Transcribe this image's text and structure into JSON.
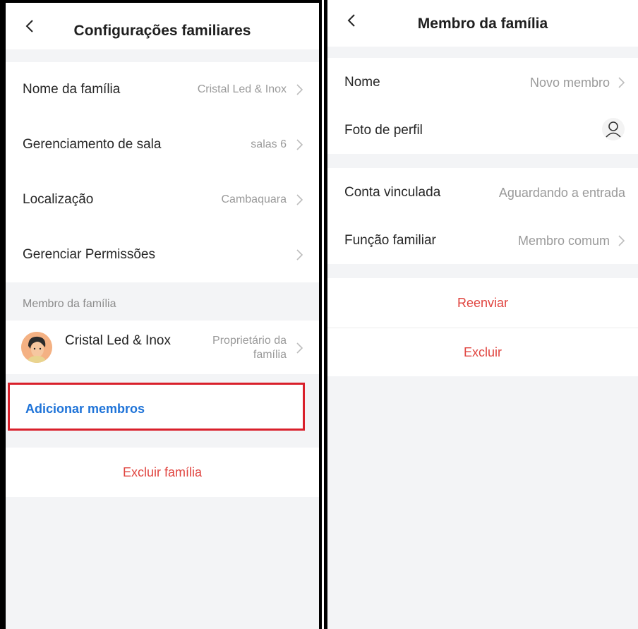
{
  "left": {
    "title": "Configurações familiares",
    "rows": [
      {
        "label": "Nome da família",
        "value": "Cristal Led & Inox"
      },
      {
        "label": "Gerenciamento de sala",
        "value": "salas 6"
      },
      {
        "label": "Localização",
        "value": "Cambaquara"
      },
      {
        "label": "Gerenciar Permissões",
        "value": ""
      }
    ],
    "members_section": "Membro da família",
    "member": {
      "name": "Cristal Led & Inox",
      "role_line1": "Proprietário da",
      "role_line2": "família"
    },
    "add_members": "Adicionar membros",
    "delete_family": "Excluir família"
  },
  "right": {
    "title": "Membro da família",
    "rows": [
      {
        "label": "Nome",
        "value": "Novo membro"
      },
      {
        "label": "Foto de perfil",
        "icon": "user-icon"
      },
      {
        "label": "Conta vinculada",
        "value": "Aguardando a entrada"
      },
      {
        "label": "Função familiar",
        "value": "Membro comum"
      }
    ],
    "resend": "Reenviar",
    "delete": "Excluir"
  },
  "colors": {
    "accent_blue": "#1e73d8",
    "danger_red": "#e0443f",
    "highlight_red": "#d9202b"
  }
}
